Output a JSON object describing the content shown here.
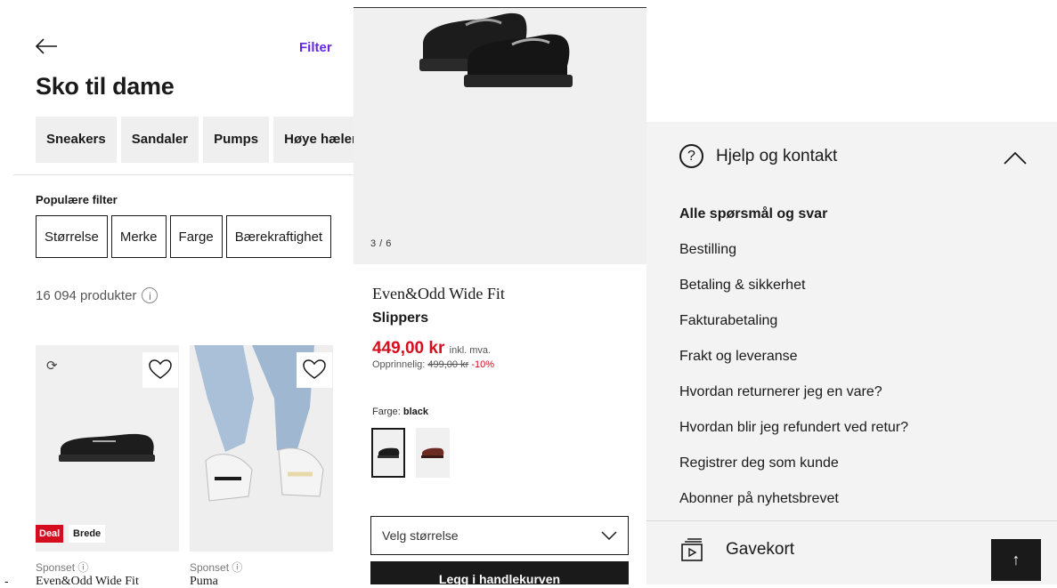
{
  "listing": {
    "filter_label": "Filter",
    "title": "Sko til dame",
    "categories": [
      "Sneakers",
      "Sandaler",
      "Pumps",
      "Høye hæler"
    ],
    "popular_label": "Populære filter",
    "popular_filters": [
      "Størrelse",
      "Merke",
      "Farge",
      "Bærekraftighet"
    ],
    "count": "16 094 produkter",
    "info_glyph": "i",
    "products": [
      {
        "deal": "Deal",
        "tag": "Brede",
        "sponsored": "Sponset ⓘ",
        "brand": "Even&Odd Wide Fit"
      },
      {
        "sponsored": "Sponset ⓘ",
        "brand": "Puma"
      }
    ]
  },
  "product": {
    "image_counter": "3 / 6",
    "brand": "Even&Odd Wide Fit",
    "name": "Slippers",
    "price": "449,00 kr",
    "vat": "inkl. mva.",
    "original_label": "Opprinnelig:",
    "original_price": "499,00 kr",
    "discount": "-10%",
    "color_label": "Farge:",
    "color_value": "black",
    "size_placeholder": "Velg størrelse",
    "add_to_cart": "Legg i handlekurven"
  },
  "help": {
    "title": "Hjelp og kontakt",
    "links": [
      "Alle spørsmål og svar",
      "Bestilling",
      "Betaling & sikkerhet",
      "Fakturabetaling",
      "Frakt og leveranse",
      "Hvordan returnerer jeg en vare?",
      "Hvordan blir jeg refundert ved retur?",
      "Registrer deg som kunde",
      "Abonner på nyhetsbrevet"
    ],
    "gift_card": "Gavekort",
    "scroll_top_glyph": "↑"
  },
  "colors": {
    "accent": "#6328e0",
    "sale": "#d50e1f",
    "dark": "#1a1a1a"
  }
}
